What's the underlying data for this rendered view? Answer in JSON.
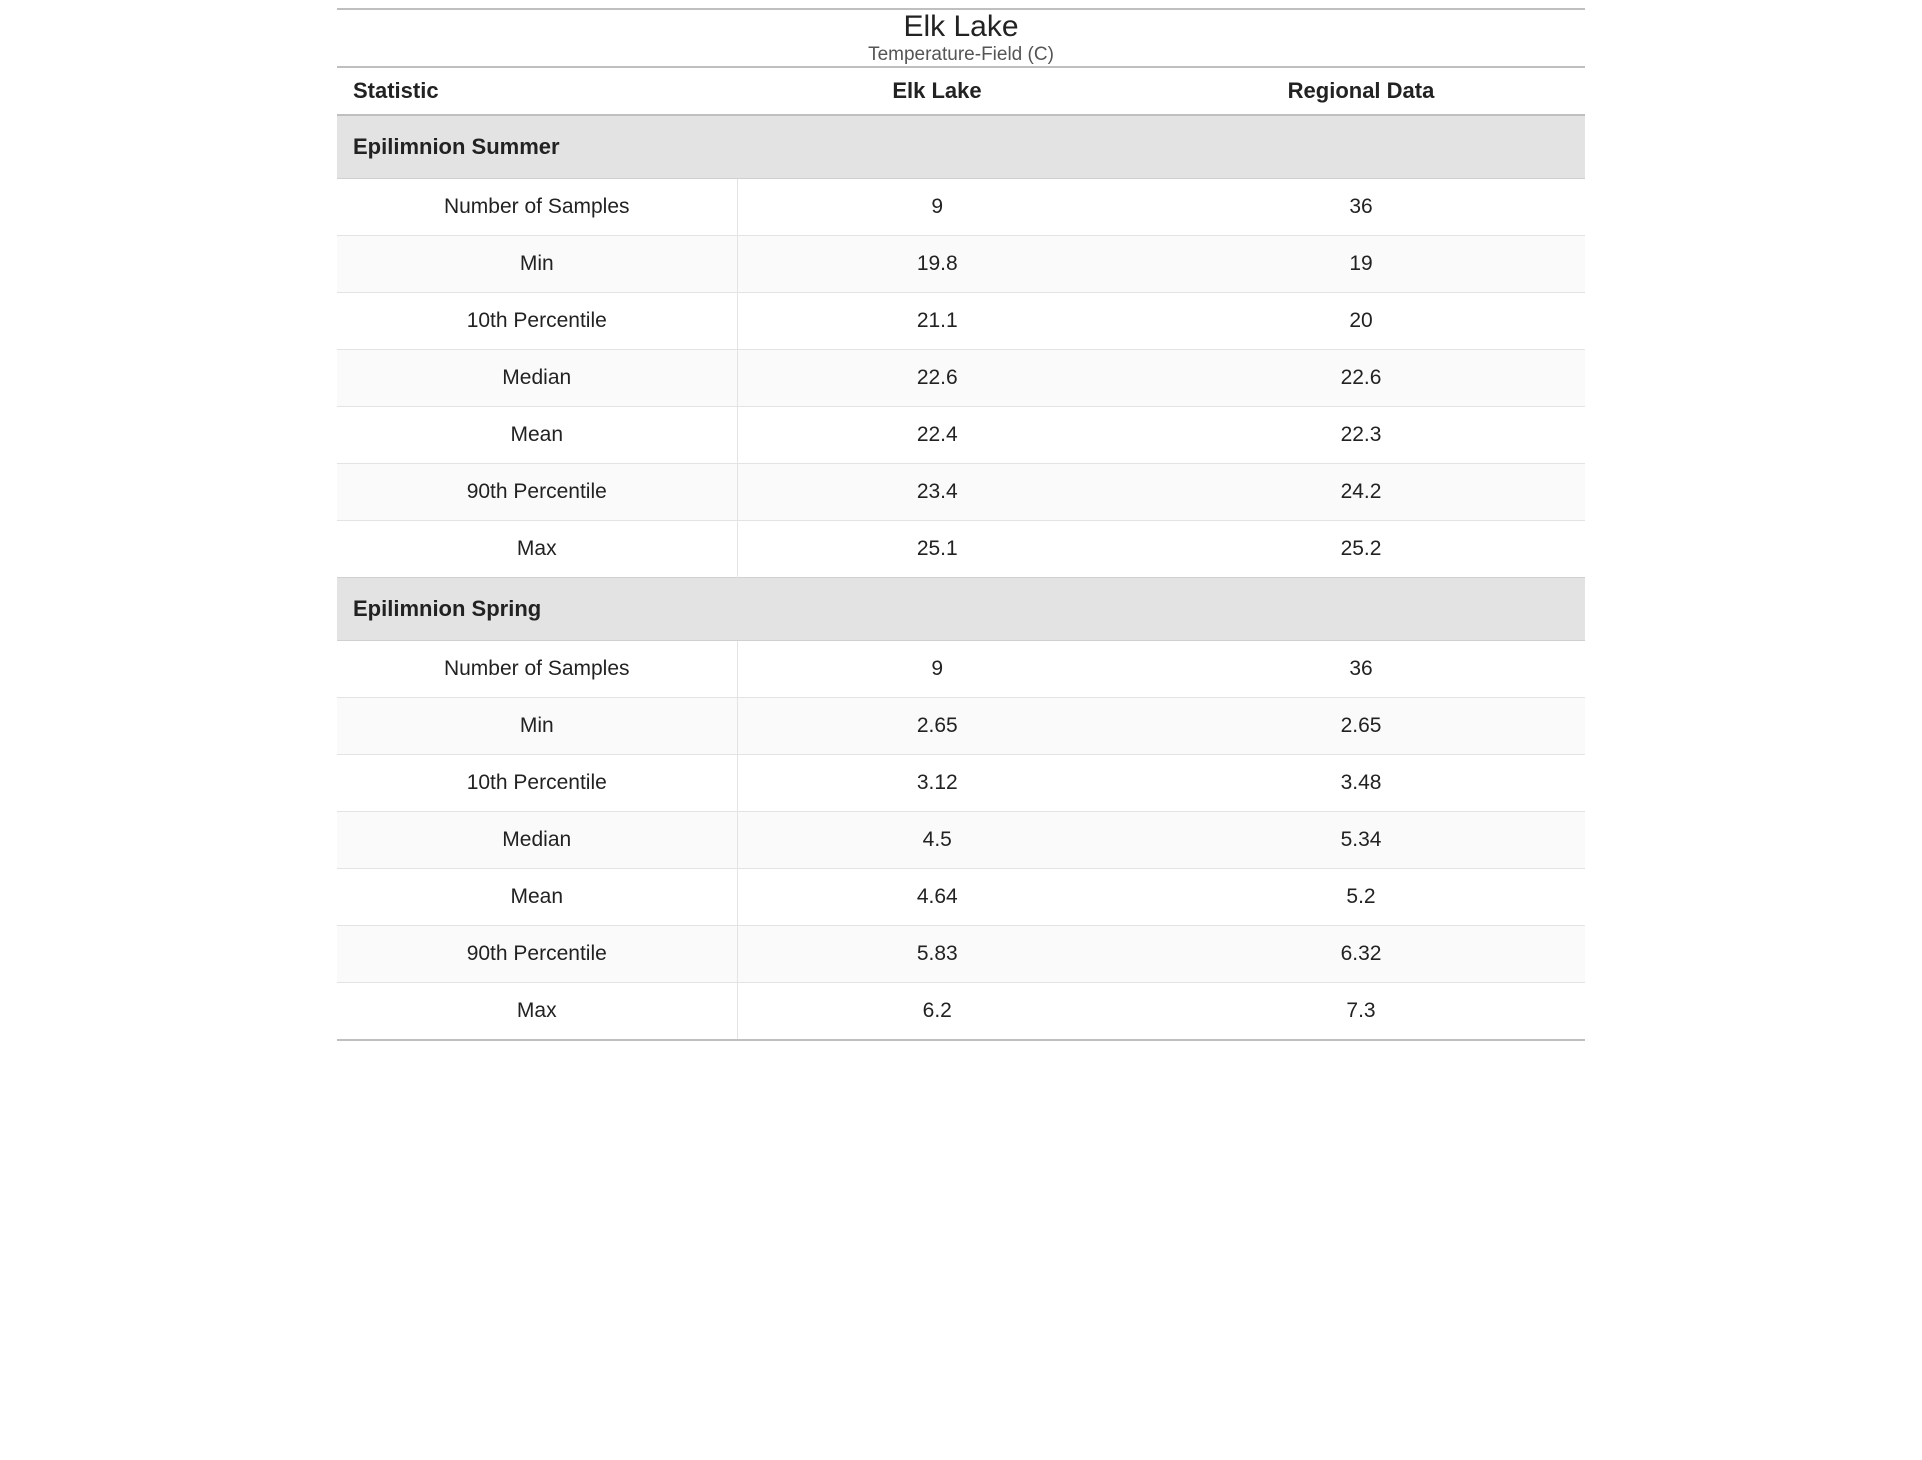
{
  "title": "Elk Lake",
  "subtitle": "Temperature-Field (C)",
  "columns": {
    "statistic": "Statistic",
    "lake": "Elk Lake",
    "regional": "Regional Data"
  },
  "sections": [
    {
      "name": "Epilimnion Summer",
      "rows": [
        {
          "stat": "Number of Samples",
          "lake": "9",
          "regional": "36"
        },
        {
          "stat": "Min",
          "lake": "19.8",
          "regional": "19"
        },
        {
          "stat": "10th Percentile",
          "lake": "21.1",
          "regional": "20"
        },
        {
          "stat": "Median",
          "lake": "22.6",
          "regional": "22.6"
        },
        {
          "stat": "Mean",
          "lake": "22.4",
          "regional": "22.3"
        },
        {
          "stat": "90th Percentile",
          "lake": "23.4",
          "regional": "24.2"
        },
        {
          "stat": "Max",
          "lake": "25.1",
          "regional": "25.2"
        }
      ]
    },
    {
      "name": "Epilimnion Spring",
      "rows": [
        {
          "stat": "Number of Samples",
          "lake": "9",
          "regional": "36"
        },
        {
          "stat": "Min",
          "lake": "2.65",
          "regional": "2.65"
        },
        {
          "stat": "10th Percentile",
          "lake": "3.12",
          "regional": "3.48"
        },
        {
          "stat": "Median",
          "lake": "4.5",
          "regional": "5.34"
        },
        {
          "stat": "Mean",
          "lake": "4.64",
          "regional": "5.2"
        },
        {
          "stat": "90th Percentile",
          "lake": "5.83",
          "regional": "6.32"
        },
        {
          "stat": "Max",
          "lake": "6.2",
          "regional": "7.3"
        }
      ]
    }
  ]
}
